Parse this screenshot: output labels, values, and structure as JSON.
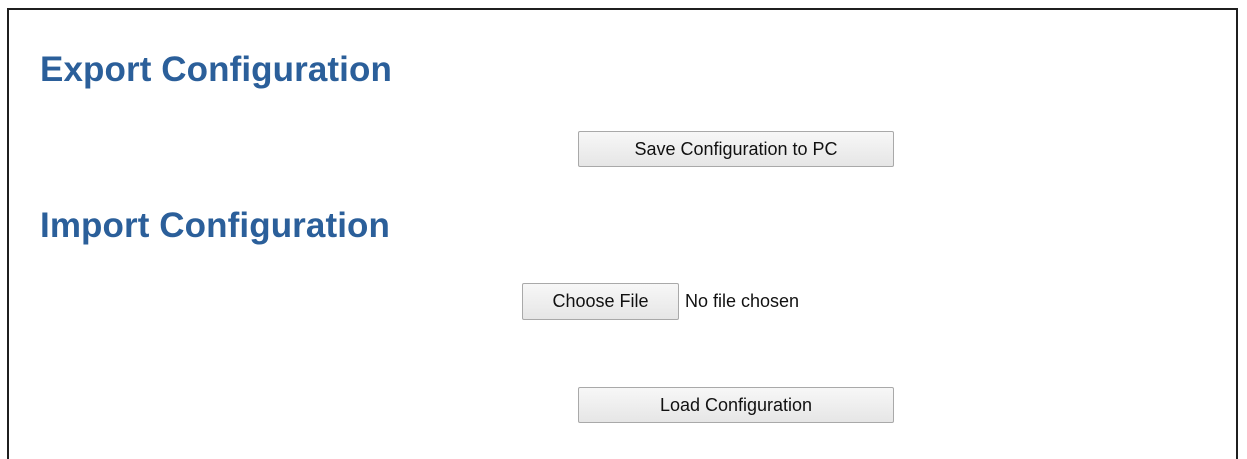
{
  "export": {
    "title": "Export Configuration",
    "save_button_label": "Save Configuration to PC"
  },
  "import": {
    "title": "Import Configuration",
    "choose_file_label": "Choose File",
    "file_status": "No file chosen",
    "load_button_label": "Load Configuration"
  },
  "colors": {
    "heading": "#2b5f9a",
    "frame_border": "#1f1f1f",
    "button_border": "#a9a9a9"
  }
}
